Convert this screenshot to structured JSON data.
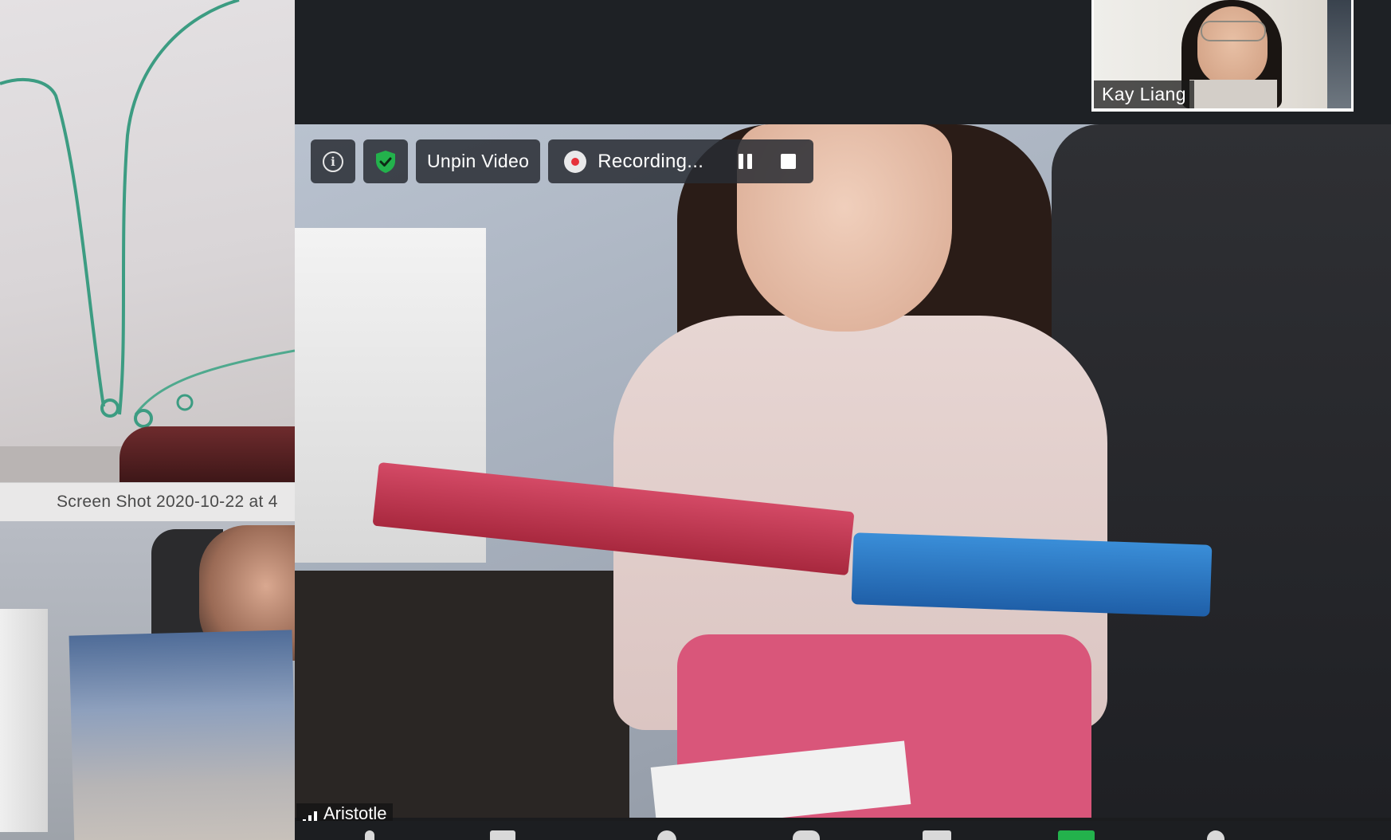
{
  "shared_screen": {
    "filename": "Screen Shot 2020-10-22 at 4"
  },
  "thumbnail": {
    "participant_name": "Kay Liang"
  },
  "main_video": {
    "participant_name": "Aristotle"
  },
  "controls": {
    "info_icon": "info-icon",
    "security_icon": "shield-check-icon",
    "unpin_label": "Unpin Video",
    "recording_label": "Recording...",
    "pause_icon": "pause-icon",
    "stop_icon": "stop-icon"
  },
  "colors": {
    "shield_green": "#23b24c",
    "record_red": "#e6323b",
    "toolbar_green": "#23b24c"
  }
}
